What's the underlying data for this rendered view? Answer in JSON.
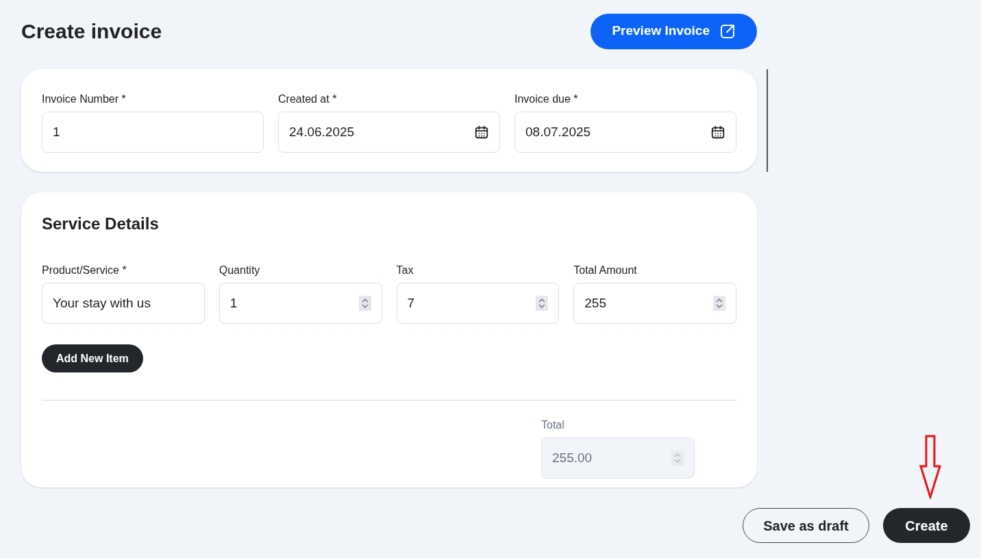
{
  "page": {
    "title": "Create invoice",
    "preview_button": "Preview Invoice"
  },
  "invoice_fields": [
    {
      "label": "Invoice Number *",
      "value": "1",
      "kind": "text"
    },
    {
      "label": "Created at *",
      "value": "24.06.2025",
      "kind": "date"
    },
    {
      "label": "Invoice due *",
      "value": "08.07.2025",
      "kind": "date"
    }
  ],
  "service_details": {
    "title": "Service Details",
    "fields": [
      {
        "label": "Product/Service *",
        "value": "Your stay with us",
        "kind": "text"
      },
      {
        "label": "Quantity",
        "value": "1",
        "kind": "number"
      },
      {
        "label": "Tax",
        "value": "7",
        "kind": "number"
      },
      {
        "label": "Total Amount",
        "value": "255",
        "kind": "number"
      }
    ],
    "add_button": "Add New Item",
    "total": {
      "label": "Total",
      "value": "255.00",
      "disabled": true
    }
  },
  "actions": [
    "Save as draft",
    "Create"
  ]
}
